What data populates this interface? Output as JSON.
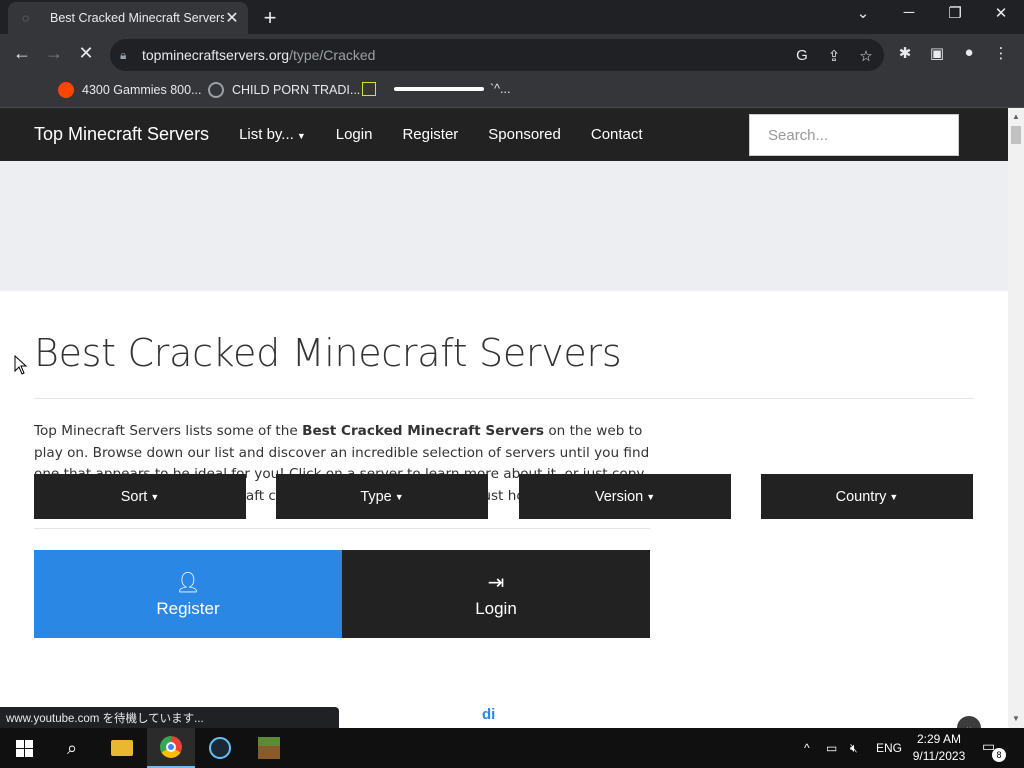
{
  "browser": {
    "tab_title": "Best Cracked Minecraft Servers",
    "url_domain": "topminecraftservers.org",
    "url_path": "/type/Cracked",
    "bookmarks": [
      {
        "label": "4300 Gammies 800...",
        "icon": "reddit-icon"
      },
      {
        "label": "CHILD PORN TRADI...",
        "icon": "globe-icon"
      },
      {
        "label": "`^...",
        "icon": "square-icon"
      }
    ],
    "status_text": "www.youtube.com を待機しています..."
  },
  "site": {
    "brand": "Top Minecraft Servers",
    "nav": {
      "list_by": "List by...",
      "login": "Login",
      "register": "Register",
      "sponsored": "Sponsored",
      "contact": "Contact"
    },
    "search_placeholder": "Search..."
  },
  "main": {
    "heading": "Best Cracked Minecraft Servers",
    "intro_before": "Top Minecraft Servers lists some of the ",
    "intro_bold": "Best Cracked Minecraft Servers",
    "intro_after": " on the web to play on. Browse down our list and discover an incredible selection of servers until you find one that appears to be ideal for you! Click on a server to learn more about it, or just copy the ip address into your Minecraft client and find out for yourself just how great it is.",
    "register_label": "Register",
    "login_label": "Login",
    "filters": {
      "sort": "Sort",
      "type": "Type",
      "version": "Version",
      "country": "Country"
    }
  },
  "badge_logo": "di",
  "taskbar": {
    "language": "ENG",
    "time": "2:29 AM",
    "date": "9/11/2023",
    "notification_count": "8"
  },
  "colors": {
    "accent_blue": "#2a87e4",
    "navbar_dark": "#222222"
  }
}
